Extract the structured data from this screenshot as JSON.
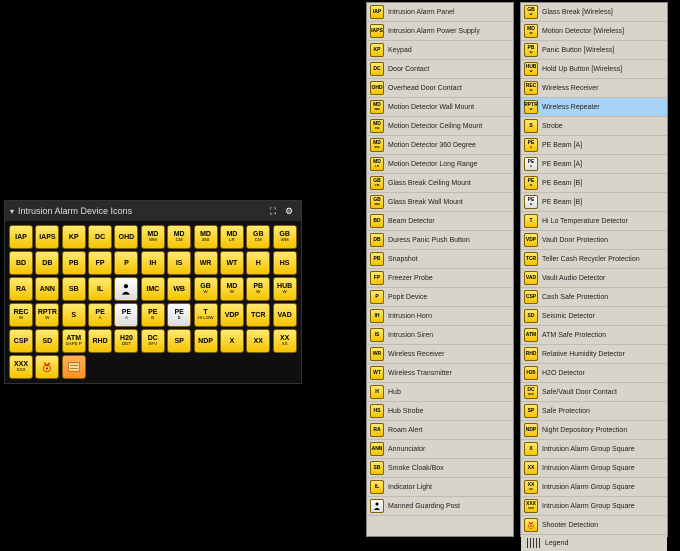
{
  "palette": {
    "title": "Intrusion Alarm Device Icons",
    "expand_label": "⛶",
    "settings_label": "⚙",
    "icons": [
      {
        "code": "IAP"
      },
      {
        "code": "IAPS"
      },
      {
        "code": "KP"
      },
      {
        "code": "DC"
      },
      {
        "code": "OHD"
      },
      {
        "code": "MD",
        "sub": "WM"
      },
      {
        "code": "MD",
        "sub": "CM"
      },
      {
        "code": "MD",
        "sub": "360"
      },
      {
        "code": "MD",
        "sub": "LR"
      },
      {
        "code": "GB",
        "sub": "CM"
      },
      {
        "code": "GB",
        "sub": "WM"
      },
      {
        "code": "BD"
      },
      {
        "code": "DB"
      },
      {
        "code": "PB"
      },
      {
        "code": "FP"
      },
      {
        "code": "P"
      },
      {
        "code": "IH"
      },
      {
        "code": "IS"
      },
      {
        "code": "WR"
      },
      {
        "code": "WT"
      },
      {
        "code": "H"
      },
      {
        "code": "HS"
      },
      {
        "code": "RA"
      },
      {
        "code": "ANN"
      },
      {
        "code": "SB"
      },
      {
        "code": "IL"
      },
      {
        "code": "",
        "svg": "person",
        "variant": "white"
      },
      {
        "code": "IMC"
      },
      {
        "code": "WB"
      },
      {
        "code": "GB",
        "sub": "W"
      },
      {
        "code": "MD",
        "sub": "W"
      },
      {
        "code": "PB",
        "sub": "W"
      },
      {
        "code": "HUB",
        "sub": "W"
      },
      {
        "code": "REC",
        "sub": "W"
      },
      {
        "code": "RPTR",
        "sub": "W"
      },
      {
        "code": "S"
      },
      {
        "code": "PE",
        "sub": "A"
      },
      {
        "code": "PE",
        "sub": "A",
        "variant": "white"
      },
      {
        "code": "PE",
        "sub": "B"
      },
      {
        "code": "PE",
        "sub": "B",
        "variant": "white"
      },
      {
        "code": "T",
        "sub": "HI LOW"
      },
      {
        "code": "VDP"
      },
      {
        "code": "TCR"
      },
      {
        "code": "VAD"
      },
      {
        "code": "CSP"
      },
      {
        "code": "SD"
      },
      {
        "code": "ATM",
        "sub": "SAFE P"
      },
      {
        "code": "RHD"
      },
      {
        "code": "H20",
        "sub": "DET"
      },
      {
        "code": "DC",
        "sub": "SFV"
      },
      {
        "code": "SP"
      },
      {
        "code": "NDP"
      },
      {
        "code": "X"
      },
      {
        "code": "XX"
      },
      {
        "code": "XX",
        "sub": "XX"
      },
      {
        "code": "XXX",
        "sub": "XXX"
      },
      {
        "code": "",
        "svg": "shooter"
      },
      {
        "code": "",
        "svg": "legend",
        "variant": "orange"
      }
    ]
  },
  "legend_col1": [
    {
      "code": "IAP",
      "label": "Intrusion Alarm Panel"
    },
    {
      "code": "IAPS",
      "label": "Intrusion Alarm Power Supply"
    },
    {
      "code": "KP",
      "label": "Keypad"
    },
    {
      "code": "DC",
      "label": "Door Contact"
    },
    {
      "code": "OHD",
      "label": "Overhead Door Contact"
    },
    {
      "code": "MD",
      "sub": "WM",
      "label": "Motion Detector Wall Mount"
    },
    {
      "code": "MD",
      "sub": "CM",
      "label": "Motion Detector Ceiling Mount"
    },
    {
      "code": "MD",
      "sub": "360",
      "label": "Motion Detector 360 Degree"
    },
    {
      "code": "MD",
      "sub": "LR",
      "label": "Motion Detector Long Range"
    },
    {
      "code": "GB",
      "sub": "CM",
      "label": "Glass Break Ceiling Mount"
    },
    {
      "code": "GB",
      "sub": "WM",
      "label": "Glass Break Wall Mount"
    },
    {
      "code": "BD",
      "label": "Beam Detector"
    },
    {
      "code": "DB",
      "label": "Duress Panic Push Button"
    },
    {
      "code": "PB",
      "label": "Snapshot"
    },
    {
      "code": "FP",
      "label": "Freezer Probe"
    },
    {
      "code": "P",
      "label": "Popit Device"
    },
    {
      "code": "IH",
      "label": "Intrusion Horn"
    },
    {
      "code": "IS",
      "label": "Intrusion Siren"
    },
    {
      "code": "WR",
      "label": "Wireless Receiver"
    },
    {
      "code": "WT",
      "label": "Wireless Transmitter"
    },
    {
      "code": "H",
      "label": "Hub"
    },
    {
      "code": "HS",
      "label": "Hub Strobe"
    },
    {
      "code": "RA",
      "label": "Roam Alert"
    },
    {
      "code": "ANN",
      "label": "Annunciator"
    },
    {
      "code": "SB",
      "label": "Smoke Cloak/Box"
    },
    {
      "code": "IL",
      "label": "Indicator Light"
    },
    {
      "code": "",
      "svg": "person",
      "variant": "white",
      "label": "Manned Guarding Post"
    }
  ],
  "legend_col2": [
    {
      "code": "GB",
      "sub": "W",
      "label": "Glass Break [Wireless]"
    },
    {
      "code": "MD",
      "sub": "W",
      "label": "Motion Detector [Wireless]"
    },
    {
      "code": "PB",
      "sub": "W",
      "label": "Panic Button [Wireless]"
    },
    {
      "code": "HUB",
      "sub": "W",
      "label": "Hold Up Button [Wireless]"
    },
    {
      "code": "REC",
      "sub": "W",
      "label": "Wireless Receiver"
    },
    {
      "code": "RPTR",
      "sub": "W",
      "label": "Wireless Repeater",
      "selected": true
    },
    {
      "code": "S",
      "label": "Strobe"
    },
    {
      "code": "PE",
      "sub": "A",
      "label": "PE Beam [A]"
    },
    {
      "code": "PE",
      "sub": "A",
      "variant": "white",
      "label": "PE Beam [A]"
    },
    {
      "code": "PE",
      "sub": "B",
      "label": "PE Beam [B]"
    },
    {
      "code": "PE",
      "sub": "B",
      "variant": "white",
      "label": "PE Beam [B]"
    },
    {
      "code": "T",
      "label": "Hi Lo Temperature Detector"
    },
    {
      "code": "VDP",
      "label": "Vault Door Protection"
    },
    {
      "code": "TCR",
      "label": "Teller Cash Recycler Protection"
    },
    {
      "code": "VAD",
      "label": "Vault Audio Detector"
    },
    {
      "code": "CSP",
      "label": "Cash Safe Protection"
    },
    {
      "code": "SD",
      "label": "Seismic Detector"
    },
    {
      "code": "ATM",
      "label": "ATM Safe Protection"
    },
    {
      "code": "RHD",
      "label": "Relative Humidity Detector"
    },
    {
      "code": "H20",
      "label": "H2O Detector"
    },
    {
      "code": "DC",
      "sub": "SFV",
      "label": "Safe/Vault Door Contact"
    },
    {
      "code": "SP",
      "label": "Safe Protection"
    },
    {
      "code": "NDP",
      "label": "Night Depository Protection"
    },
    {
      "code": "X",
      "label": "Intrusion Alarm Group Square"
    },
    {
      "code": "XX",
      "label": "Intrusion Alarm Group Square"
    },
    {
      "code": "XX",
      "sub": "XX",
      "label": "Intrusion Alarm Group Square"
    },
    {
      "code": "XXX",
      "sub": "XXX",
      "label": "Intrusion Alarm Group Square"
    },
    {
      "code": "",
      "svg": "shooter",
      "label": "Shooter Detection"
    }
  ],
  "legend_footer": "Legend"
}
